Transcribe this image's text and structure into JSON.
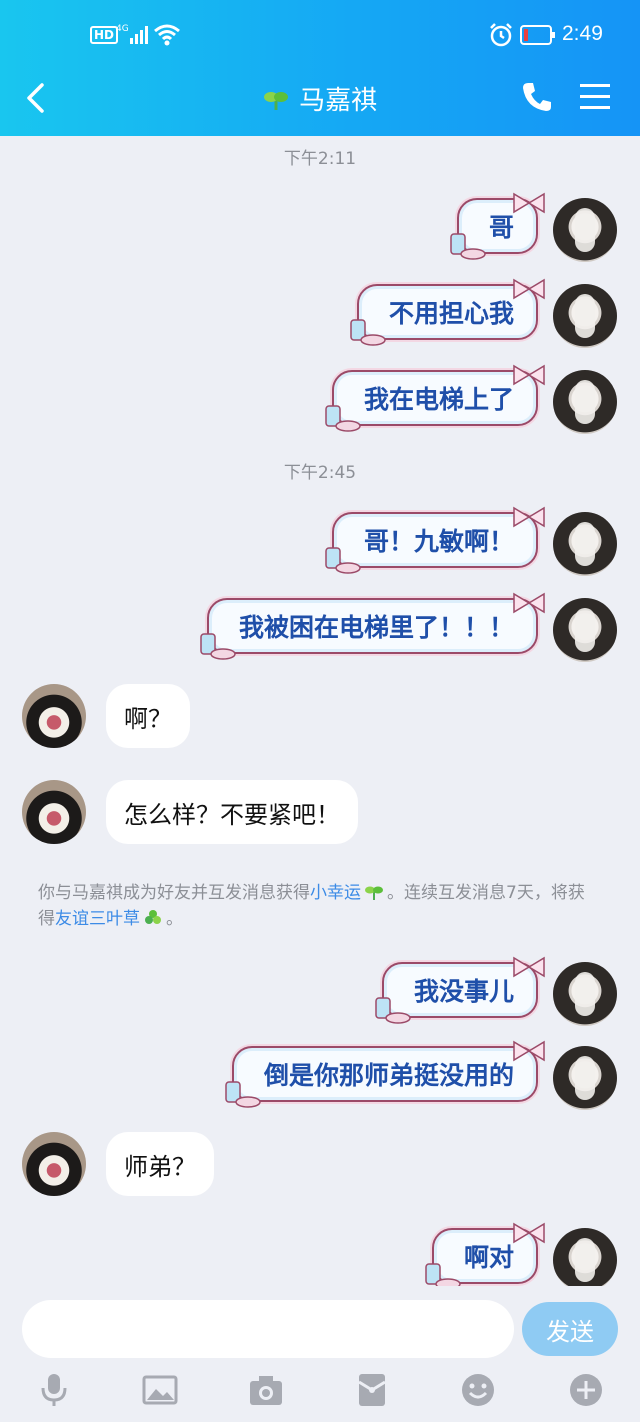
{
  "status_bar": {
    "hd": "HD",
    "network": "4G",
    "time": "2:49"
  },
  "header": {
    "title": "马嘉祺"
  },
  "timestamps": {
    "t1": "下午2:11",
    "t2": "下午2:45"
  },
  "messages": {
    "m1": "哥",
    "m2": "不用担心我",
    "m3": "我在电梯上了",
    "m4": "哥！九敏啊！",
    "m5": "我被困在电梯里了！！！",
    "f1": "啊？",
    "f2": "怎么样？不要紧吧！",
    "m6": "我没事儿",
    "m7": "倒是你那师弟挺没用的",
    "f3": "师弟？",
    "m8": "啊对"
  },
  "notice": {
    "part1": "你与马嘉祺成为好友并互发消息获得",
    "link1": "小幸运",
    "part2": "。连续互发消息7天，将获得",
    "link2": "友谊三叶草",
    "part3": "。"
  },
  "input": {
    "placeholder": "",
    "send_label": "发送"
  },
  "colors": {
    "header_start": "#19c6ef",
    "header_end": "#1594f6",
    "bubble_text": "#1f4fa9",
    "link": "#3c8be6"
  }
}
